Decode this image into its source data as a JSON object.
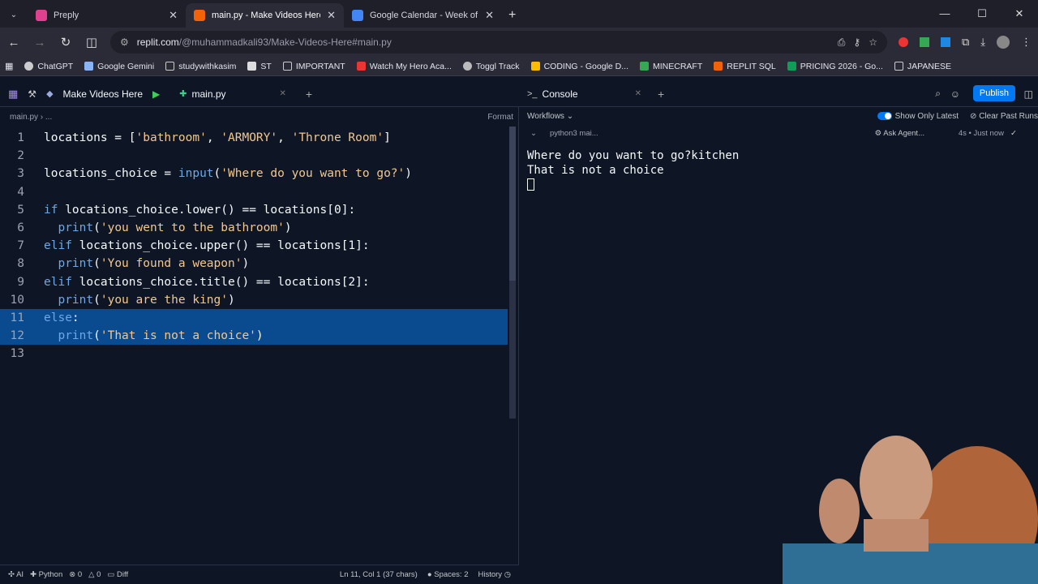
{
  "browser": {
    "tabs": [
      {
        "title": "Preply",
        "color": "#e0418f"
      },
      {
        "title": "main.py - Make Videos Here - Repl",
        "color": "#f26207"
      },
      {
        "title": "Google Calendar - Week of Feb",
        "color": "#4285f4"
      }
    ],
    "url_host": "replit.com",
    "url_path": "/@muhammadkali93/Make-Videos-Here#main.py",
    "bookmarks": [
      "ChatGPT",
      "Google Gemini",
      "studywithkasim",
      "ST",
      "IMPORTANT",
      "Watch My Hero Aca...",
      "Toggl Track",
      "CODING - Google D...",
      "MINECRAFT",
      "REPLIT SQL",
      "PRICING 2026 - Go...",
      "JAPANESE"
    ]
  },
  "workspace": {
    "project_name": "Make Videos Here",
    "file_tab": "main.py",
    "console_tab": "Console",
    "publish_label": "Publish"
  },
  "editor": {
    "breadcrumb": "main.py  ›  ...",
    "format_label": "Format",
    "lines": [
      {
        "n": "1",
        "text": "locations = ['bathroom', 'ARMORY', 'Throne Room']"
      },
      {
        "n": "2",
        "text": ""
      },
      {
        "n": "3",
        "text": "locations_choice = input('Where do you want to go?')"
      },
      {
        "n": "4",
        "text": ""
      },
      {
        "n": "5",
        "text": "if locations_choice.lower() == locations[0]:"
      },
      {
        "n": "6",
        "text": "  print('you went to the bathroom')"
      },
      {
        "n": "7",
        "text": "elif locations_choice.upper() == locations[1]:"
      },
      {
        "n": "8",
        "text": "  print('You found a weapon')"
      },
      {
        "n": "9",
        "text": "elif locations_choice.title() == locations[2]:"
      },
      {
        "n": "10",
        "text": "  print('you are the king')"
      },
      {
        "n": "11",
        "text": "else:"
      },
      {
        "n": "12",
        "text": "  print('That is not a choice')"
      },
      {
        "n": "13",
        "text": ""
      }
    ]
  },
  "console": {
    "workflows_label": "Workflows",
    "show_only_latest": "Show Only Latest",
    "clear_past_runs": "Clear Past Runs",
    "run_name": "python3 mai...",
    "ask_agent": "Ask Agent...",
    "run_time": "4s • Just now",
    "output_lines": [
      "Where do you want to go?kitchen",
      "That is not a choice"
    ]
  },
  "status": {
    "ai": "AI",
    "language": "Python",
    "errors": "0",
    "warnings": "0",
    "diff": "Diff",
    "cursor": "Ln 11, Col 1 (37 chars)",
    "spaces": "Spaces: 2",
    "history": "History"
  }
}
